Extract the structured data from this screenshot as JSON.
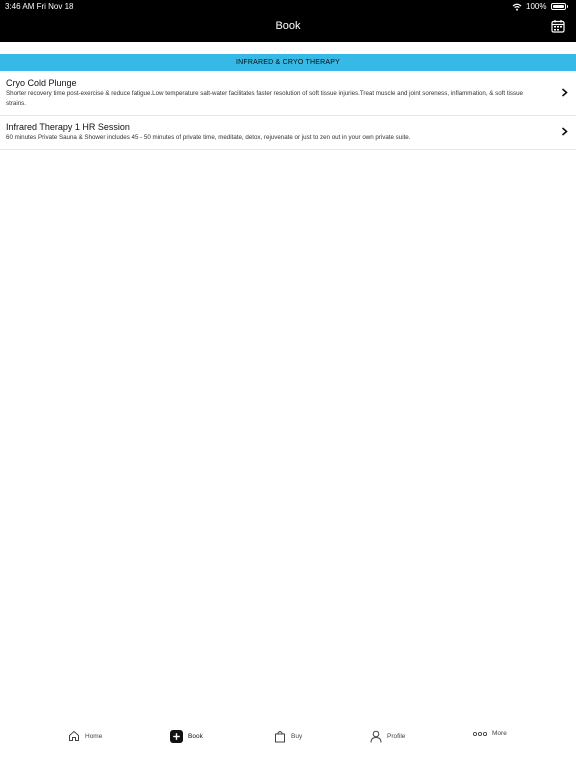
{
  "status_bar": {
    "time": "3:46 AM  Fri Nov 18",
    "battery": "100%"
  },
  "nav": {
    "title": "Book",
    "right_icon": "calendar-icon"
  },
  "section": {
    "header": "INFRARED & CRYO THERAPY",
    "color": "#36b9e6"
  },
  "services": [
    {
      "title": "Cryo Cold Plunge",
      "description": "Shorter recovery time post-exercise & reduce fatigue.Low temperature salt-water facilitates faster resolution of soft tissue injuries.Treat muscle and joint soreness, inflammation, & soft tissue strains."
    },
    {
      "title": "Infrared Therapy 1 HR Session",
      "description": "60 minutes Private Sauna & Shower includes 45 - 50 minutes of private time, meditate, detox, rejuvenate or just to zen out in your own private suite."
    }
  ],
  "tabbar": {
    "tabs": [
      {
        "label": "Home",
        "icon": "home-icon"
      },
      {
        "label": "Book",
        "icon": "plus-icon"
      },
      {
        "label": "Buy",
        "icon": "bag-icon"
      },
      {
        "label": "Profile",
        "icon": "person-icon"
      },
      {
        "label": "More",
        "icon": "more-icon"
      }
    ]
  }
}
